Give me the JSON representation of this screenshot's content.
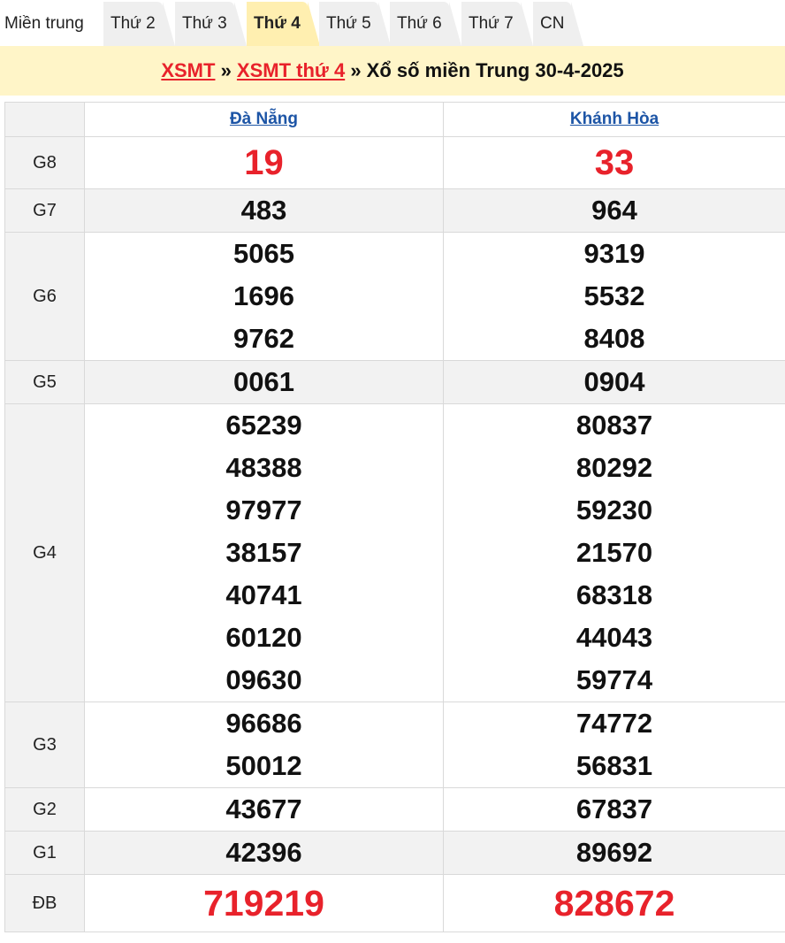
{
  "tabs": [
    "Miền trung",
    "Thứ 2",
    "Thứ 3",
    "Thứ 4",
    "Thứ 5",
    "Thứ 6",
    "Thứ 7",
    "CN"
  ],
  "title": {
    "link1": "XSMT",
    "sep1": " » ",
    "link2": "XSMT thứ 4",
    "rest": " » Xổ số miền Trung 30-4-2025"
  },
  "provinces": [
    "Đà Nẵng",
    "Khánh Hòa"
  ],
  "prizes": [
    {
      "label": "G8",
      "a": [
        "19"
      ],
      "b": [
        "33"
      ]
    },
    {
      "label": "G7",
      "a": [
        "483"
      ],
      "b": [
        "964"
      ]
    },
    {
      "label": "G6",
      "a": [
        "5065",
        "1696",
        "9762"
      ],
      "b": [
        "9319",
        "5532",
        "8408"
      ]
    },
    {
      "label": "G5",
      "a": [
        "0061"
      ],
      "b": [
        "0904"
      ]
    },
    {
      "label": "G4",
      "a": [
        "65239",
        "48388",
        "97977",
        "38157",
        "40741",
        "60120",
        "09630"
      ],
      "b": [
        "80837",
        "80292",
        "59230",
        "21570",
        "68318",
        "44043",
        "59774"
      ]
    },
    {
      "label": "G3",
      "a": [
        "96686",
        "50012"
      ],
      "b": [
        "74772",
        "56831"
      ]
    },
    {
      "label": "G2",
      "a": [
        "43677"
      ],
      "b": [
        "67837"
      ]
    },
    {
      "label": "G1",
      "a": [
        "42396"
      ],
      "b": [
        "89692"
      ]
    },
    {
      "label": "ĐB",
      "a": [
        "719219"
      ],
      "b": [
        "828672"
      ]
    }
  ]
}
